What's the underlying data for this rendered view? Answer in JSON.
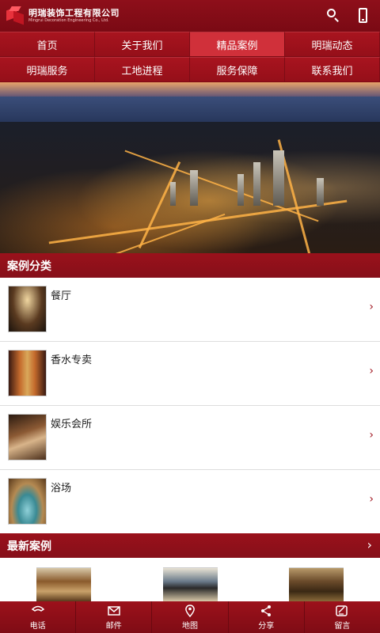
{
  "header": {
    "logo_cn": "明瑞装饰工程有限公司",
    "logo_en": "Mingrui Decoration Engineering Co., Ltd."
  },
  "nav": {
    "items": [
      {
        "label": "首页"
      },
      {
        "label": "关于我们"
      },
      {
        "label": "精品案例"
      },
      {
        "label": "明瑞动态"
      },
      {
        "label": "明瑞服务"
      },
      {
        "label": "工地进程"
      },
      {
        "label": "服务保障"
      },
      {
        "label": "联系我们"
      }
    ],
    "active_index": 2
  },
  "categories": {
    "title": "案例分类",
    "items": [
      {
        "label": "餐厅",
        "chevron": "›"
      },
      {
        "label": "香水专卖",
        "chevron": "›"
      },
      {
        "label": "娱乐会所",
        "chevron": "›"
      },
      {
        "label": "浴场",
        "chevron": "›"
      }
    ]
  },
  "latest": {
    "title": "最新案例",
    "chevron": "›"
  },
  "bottombar": {
    "items": [
      {
        "label": "电话",
        "icon": "phone-icon"
      },
      {
        "label": "邮件",
        "icon": "mail-icon"
      },
      {
        "label": "地图",
        "icon": "map-pin-icon"
      },
      {
        "label": "分享",
        "icon": "share-icon"
      },
      {
        "label": "留言",
        "icon": "message-icon"
      }
    ]
  },
  "colors": {
    "brand_red": "#9a111b",
    "active_nav": "#d0303a"
  }
}
